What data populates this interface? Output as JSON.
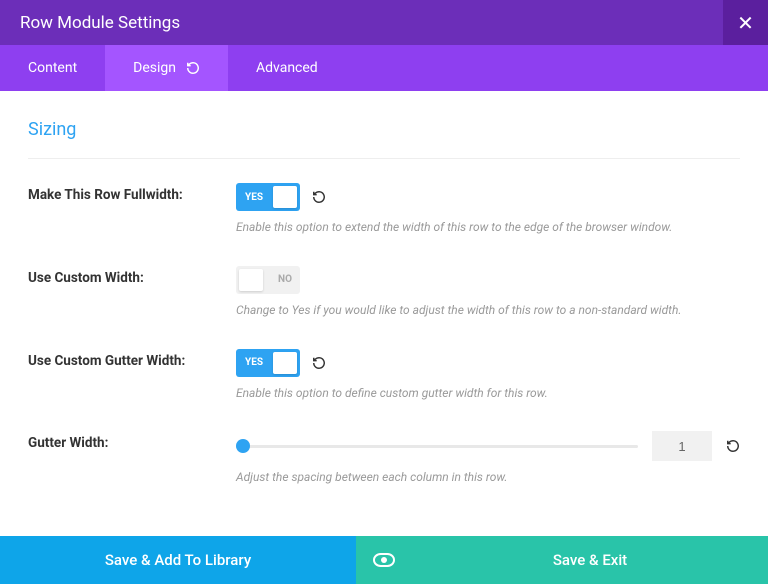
{
  "header": {
    "title": "Row Module Settings"
  },
  "tabs": {
    "content": "Content",
    "design": "Design",
    "advanced": "Advanced"
  },
  "section": {
    "title": "Sizing"
  },
  "fullwidth": {
    "label": "Make This Row Fullwidth:",
    "value": "YES",
    "help": "Enable this option to extend the width of this row to the edge of the browser window."
  },
  "custom_width": {
    "label": "Use Custom Width:",
    "value": "NO",
    "help": "Change to Yes if you would like to adjust the width of this row to a non-standard width."
  },
  "custom_gutter": {
    "label": "Use Custom Gutter Width:",
    "value": "YES",
    "help": "Enable this option to define custom gutter width for this row."
  },
  "gutter_width": {
    "label": "Gutter Width:",
    "value": "1",
    "help": "Adjust the spacing between each column in this row."
  },
  "footer": {
    "library": "Save & Add To Library",
    "save_exit": "Save & Exit"
  }
}
